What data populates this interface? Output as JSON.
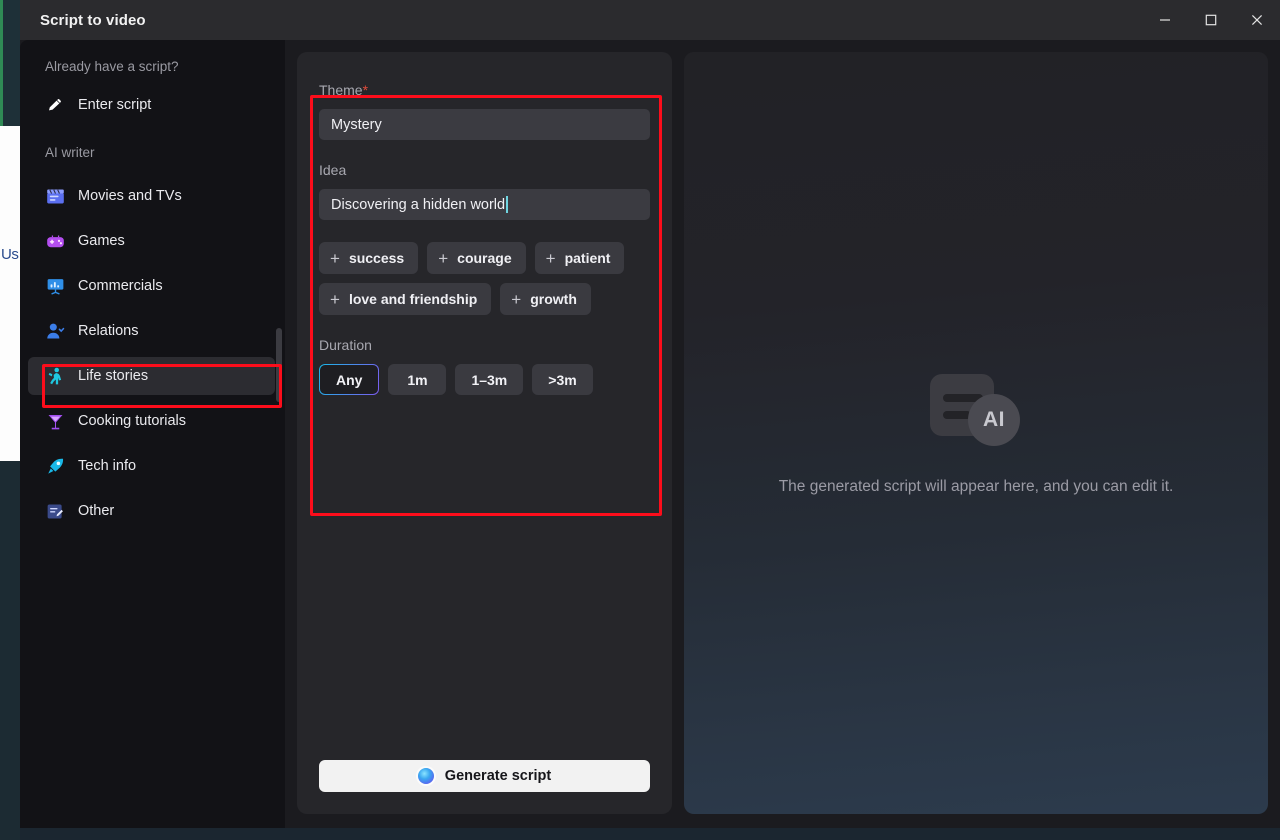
{
  "window": {
    "title": "Script to video",
    "controls": [
      {
        "name": "minimize-button",
        "glyph": "minimize-icon"
      },
      {
        "name": "maximize-button",
        "glyph": "maximize-icon"
      },
      {
        "name": "close-button",
        "glyph": "close-icon"
      }
    ]
  },
  "background": {
    "edge_text": "Us"
  },
  "sidebar": {
    "headings": {
      "script": "Already have a script?",
      "ai_writer": "AI writer"
    },
    "enter_script": {
      "label": "Enter script",
      "icon": "pencil-icon"
    },
    "items": [
      {
        "label": "Movies and TVs",
        "icon": "clapperboard-icon",
        "selected": false
      },
      {
        "label": "Games",
        "icon": "gamepad-icon",
        "selected": false
      },
      {
        "label": "Commercials",
        "icon": "presentation-icon",
        "selected": false
      },
      {
        "label": "Relations",
        "icon": "people-icon",
        "selected": false
      },
      {
        "label": "Life stories",
        "icon": "person-walk-icon",
        "selected": true
      },
      {
        "label": "Cooking tutorials",
        "icon": "cocktail-icon",
        "selected": false
      },
      {
        "label": "Tech info",
        "icon": "rocket-icon",
        "selected": false
      },
      {
        "label": "Other",
        "icon": "note-edit-icon",
        "selected": false
      }
    ]
  },
  "form": {
    "theme": {
      "label": "Theme",
      "required_mark": "*",
      "value": "Mystery"
    },
    "idea": {
      "label": "Idea",
      "value": "Discovering a hidden world",
      "placeholder": "Discovering a hidden world"
    },
    "chips": [
      {
        "label": "success"
      },
      {
        "label": "courage"
      },
      {
        "label": "patient"
      },
      {
        "label": "love and friendship"
      },
      {
        "label": "growth"
      }
    ],
    "chip_prefix": "+",
    "duration": {
      "label": "Duration",
      "options": [
        {
          "label": "Any",
          "selected": true
        },
        {
          "label": "1m",
          "selected": false
        },
        {
          "label": "1–3m",
          "selected": false
        },
        {
          "label": ">3m",
          "selected": false
        }
      ]
    },
    "generate_button": {
      "label": "Generate script",
      "icon": "ai-sphere-icon"
    }
  },
  "preview": {
    "icon_badge": "AI",
    "placeholder": "The generated script will appear here, and you can edit it."
  },
  "colors": {
    "accent_gradient_start": "#19b8e8",
    "accent_gradient_end": "#7b5cf0",
    "annotation": "#fc0d1b",
    "required": "#e04a3a",
    "sidebar_bg": "#121216",
    "panel_bg": "#26262a"
  }
}
